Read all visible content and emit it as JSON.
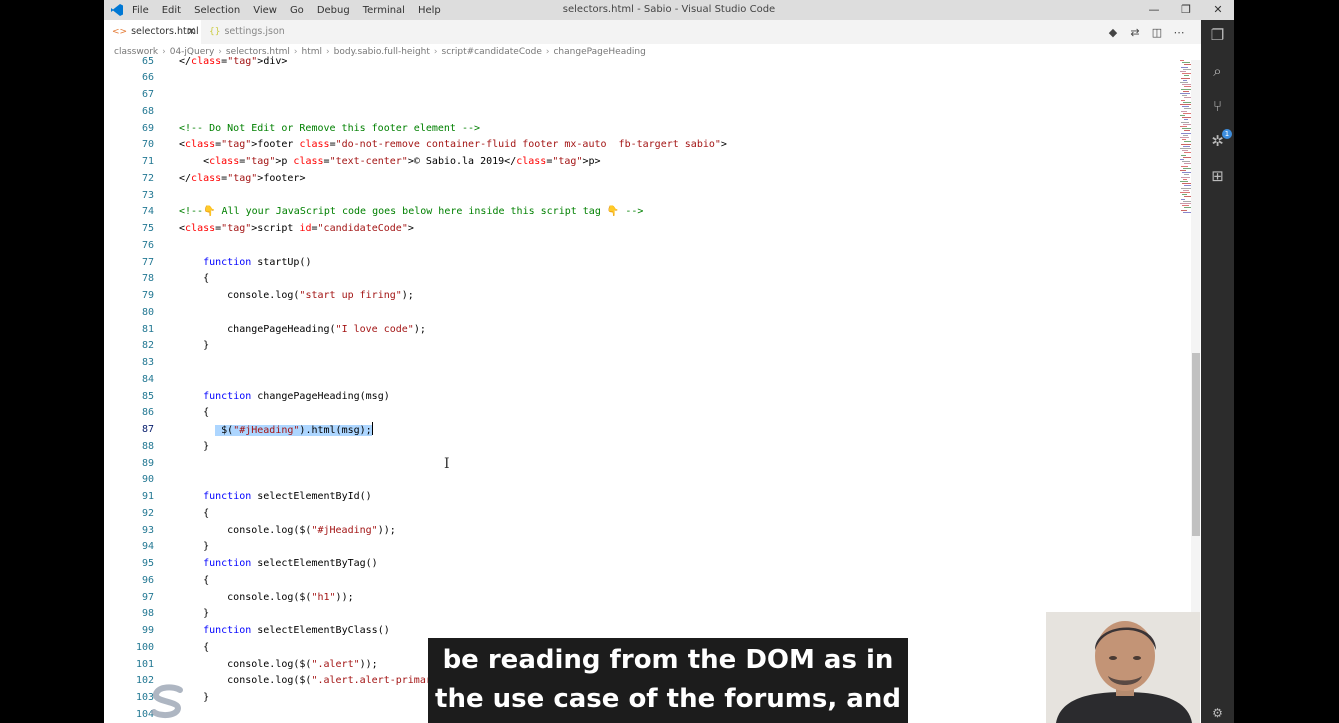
{
  "titlebar": {
    "menu": [
      "File",
      "Edit",
      "Selection",
      "View",
      "Go",
      "Debug",
      "Terminal",
      "Help"
    ],
    "title": "selectors.html - Sabio - Visual Studio Code"
  },
  "tabs": [
    {
      "label": "selectors.html",
      "icon": "html-file-icon",
      "active": true
    },
    {
      "label": "settings.json",
      "icon": "json-file-icon",
      "active": false
    }
  ],
  "breadcrumb": [
    "classwork",
    "04-jQuery",
    "selectors.html",
    "html",
    "body.sabio.full-height",
    "script#candidateCode",
    "changePageHeading"
  ],
  "editor": {
    "current_line": "87",
    "lines": [
      {
        "n": "65",
        "text": "</div>"
      },
      {
        "n": "66",
        "text": ""
      },
      {
        "n": "67",
        "text": ""
      },
      {
        "n": "68",
        "text": ""
      },
      {
        "n": "69",
        "text": "<!-- Do Not Edit or Remove this footer element -->"
      },
      {
        "n": "70",
        "text": "<footer class=\"do-not-remove container-fluid footer mx-auto  fb-targert sabio\">"
      },
      {
        "n": "71",
        "text": "    <p class=\"text-center\">© Sabio.la 2019</p>"
      },
      {
        "n": "72",
        "text": "</footer>"
      },
      {
        "n": "73",
        "text": ""
      },
      {
        "n": "74",
        "text": "<!--👇 All your JavaScript code goes below here inside this script tag 👇 -->"
      },
      {
        "n": "75",
        "text": "<script id=\"candidateCode\">"
      },
      {
        "n": "76",
        "text": ""
      },
      {
        "n": "77",
        "text": "    function startUp()"
      },
      {
        "n": "78",
        "text": "    {"
      },
      {
        "n": "79",
        "text": "        console.log(\"start up firing\");"
      },
      {
        "n": "80",
        "text": ""
      },
      {
        "n": "81",
        "text": "        changePageHeading(\"I love code\");"
      },
      {
        "n": "82",
        "text": "    }"
      },
      {
        "n": "83",
        "text": ""
      },
      {
        "n": "84",
        "text": ""
      },
      {
        "n": "85",
        "text": "    function changePageHeading(msg)"
      },
      {
        "n": "86",
        "text": "    {"
      },
      {
        "n": "87",
        "text": "        $(\"#jHeading\").html(msg);"
      },
      {
        "n": "88",
        "text": "    }"
      },
      {
        "n": "89",
        "text": ""
      },
      {
        "n": "90",
        "text": ""
      },
      {
        "n": "91",
        "text": "    function selectElementById()"
      },
      {
        "n": "92",
        "text": "    {"
      },
      {
        "n": "93",
        "text": "        console.log($(\"#jHeading\"));"
      },
      {
        "n": "94",
        "text": "    }"
      },
      {
        "n": "95",
        "text": "    function selectElementByTag()"
      },
      {
        "n": "96",
        "text": "    {"
      },
      {
        "n": "97",
        "text": "        console.log($(\"h1\"));"
      },
      {
        "n": "98",
        "text": "    }"
      },
      {
        "n": "99",
        "text": "    function selectElementByClass()"
      },
      {
        "n": "100",
        "text": "    {"
      },
      {
        "n": "101",
        "text": "        console.log($(\".alert\"));"
      },
      {
        "n": "102",
        "text": "        console.log($(\".alert.alert-primary\").length);"
      },
      {
        "n": "103",
        "text": "    }"
      },
      {
        "n": "104",
        "text": ""
      }
    ]
  },
  "activity_bar": {
    "items": [
      "explorer-icon",
      "search-icon",
      "source-control-icon",
      "debug-icon",
      "extensions-icon",
      "settings-gear-icon"
    ],
    "source_control_badge": "1"
  },
  "caption": {
    "line1": "be reading from the DOM as in",
    "line2": "the use case of the forums, and"
  },
  "colors": {
    "comment": "#008000",
    "tag": "#800000",
    "attribute": "#ff0000",
    "string": "#a31515",
    "keyword": "#0000ff",
    "selection": "#add6ff",
    "line_number": "#237893"
  }
}
